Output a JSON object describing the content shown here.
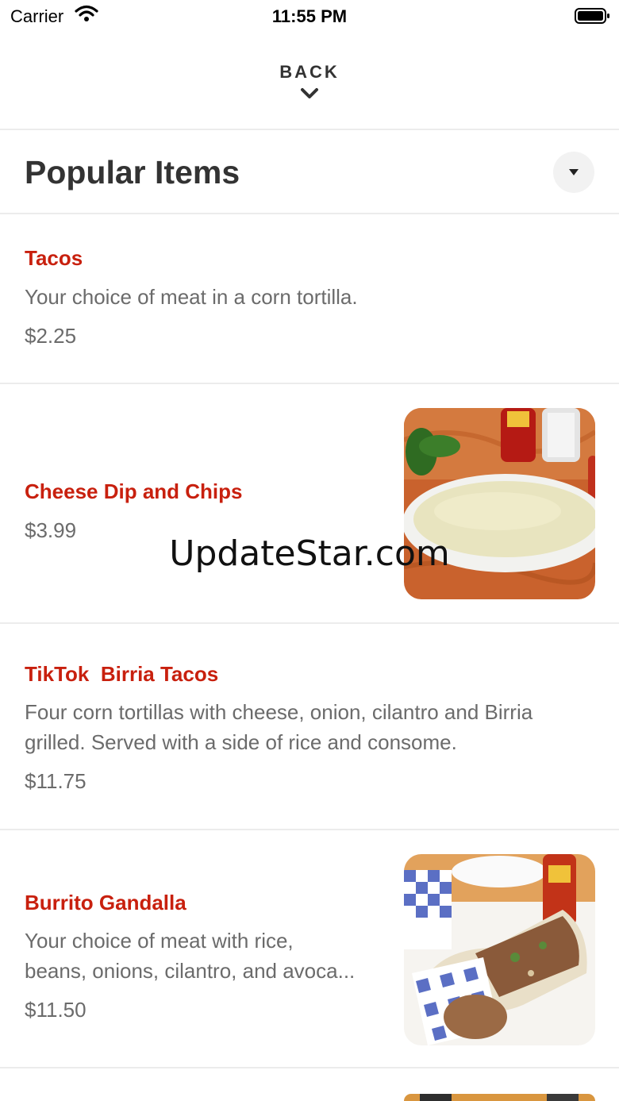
{
  "status_bar": {
    "carrier": "Carrier",
    "time": "11:55 PM"
  },
  "nav": {
    "back_label": "BACK"
  },
  "section": {
    "title": "Popular Items"
  },
  "items": [
    {
      "name": "Tacos",
      "description": "Your choice of meat in a corn tortilla.",
      "price": "$2.25"
    },
    {
      "name": "Cheese Dip and Chips",
      "price": "$3.99"
    },
    {
      "name": "TikTok  Birria Tacos",
      "description_line1": "Four corn tortillas with cheese, onion, cilantro and Birria",
      "description_line2": "grilled. Served with a side of rice and consome.",
      "price": "$11.75"
    },
    {
      "name": "Burrito Gandalla",
      "description_line1": "Your choice of meat with rice,",
      "description_line2": "beans, onions, cilantro, and avoca...",
      "price": "$11.50"
    }
  ],
  "watermark": "UpdateStar.com",
  "colors": {
    "accent": "#c8200e",
    "muted_text": "#6b6b6b",
    "divider": "#ececec"
  }
}
